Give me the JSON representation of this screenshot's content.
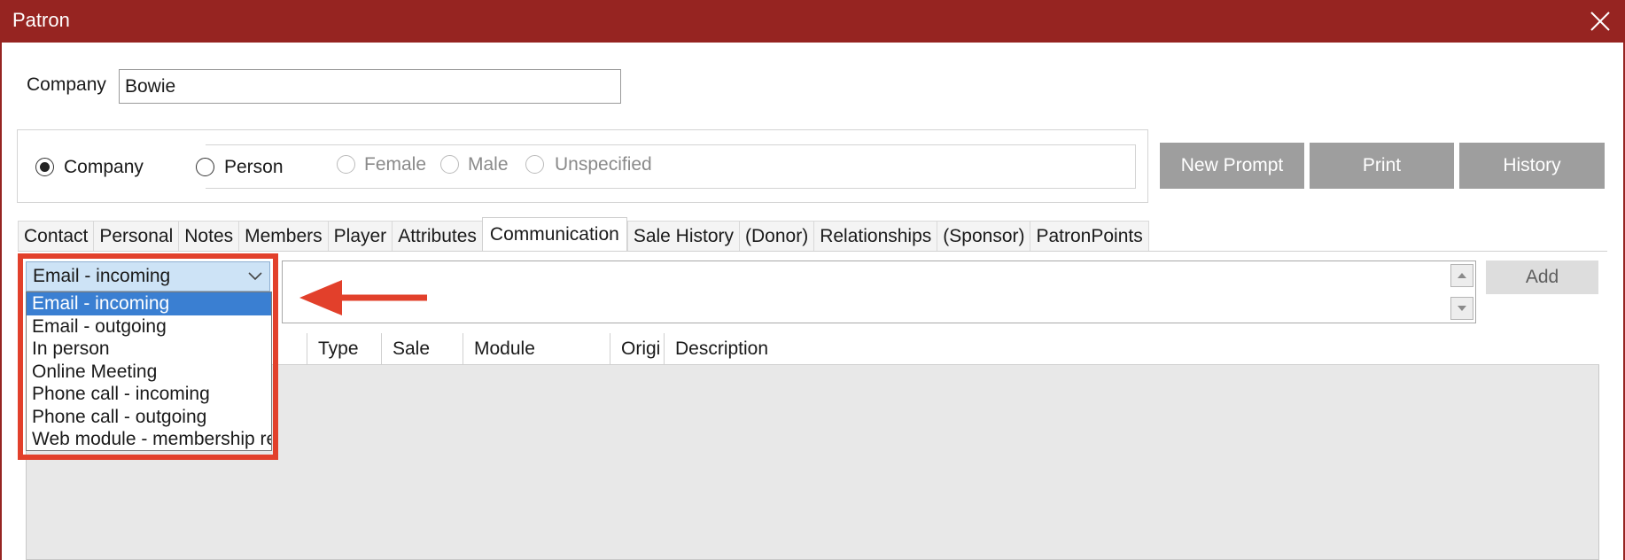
{
  "window": {
    "title": "Patron",
    "accent_color": "#962421"
  },
  "company_row": {
    "label": "Company",
    "value": "Bowie"
  },
  "patron_type": {
    "options": [
      "Company",
      "Person"
    ],
    "selected": "Company",
    "gender_options": [
      "Female",
      "Male",
      "Unspecified"
    ]
  },
  "actions": {
    "new_prompt": "New Prompt",
    "print": "Print",
    "history": "History"
  },
  "tabs": [
    {
      "label": "Contact"
    },
    {
      "label": "Personal"
    },
    {
      "label": "Notes"
    },
    {
      "label": "Members"
    },
    {
      "label": "Player"
    },
    {
      "label": "Attributes"
    },
    {
      "label": "Communication",
      "active": true
    },
    {
      "label": "Sale History"
    },
    {
      "label": "(Donor)"
    },
    {
      "label": "Relationships"
    },
    {
      "label": "(Sponsor)"
    },
    {
      "label": "PatronPoints"
    }
  ],
  "communication": {
    "type_value": "Email - incoming",
    "type_options": [
      "Email - incoming",
      "Email - outgoing",
      "In person",
      "Online Meeting",
      "Phone call - incoming",
      "Phone call - outgoing",
      "Web module - membership re"
    ],
    "selected_option": "Email - incoming",
    "add_label": "Add",
    "grid_columns": [
      "",
      "Type",
      "Sale",
      "Module",
      "Origi",
      "Description"
    ]
  },
  "annotation": {
    "highlight_color": "#e2402b"
  }
}
